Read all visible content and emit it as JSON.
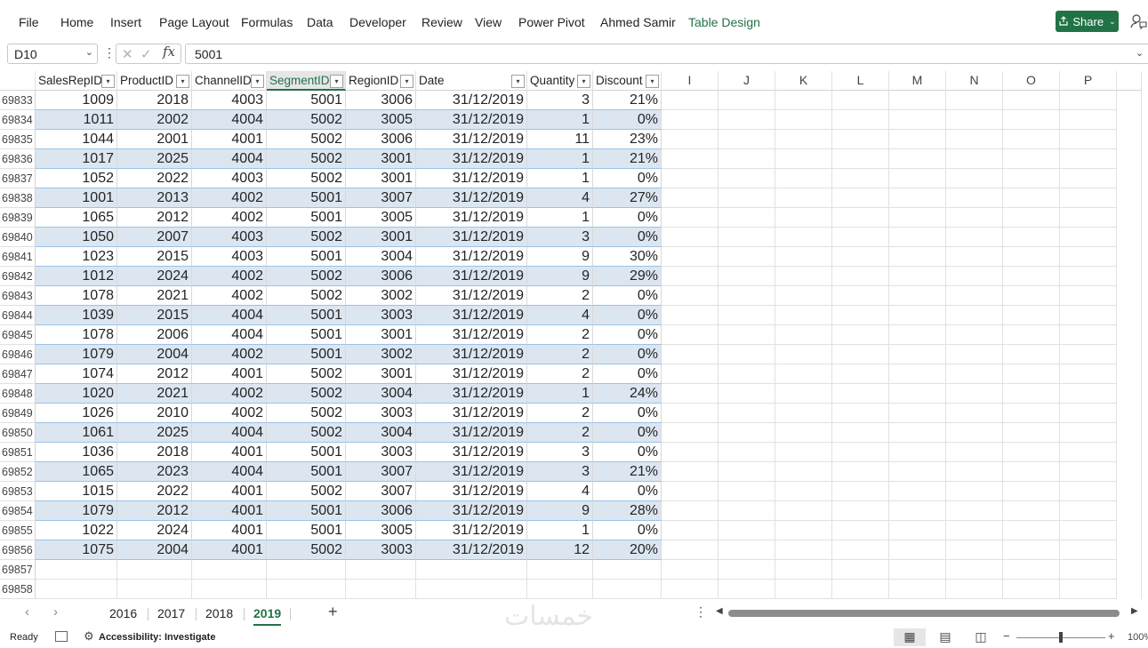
{
  "ribbon": {
    "tabs": [
      "File",
      "Home",
      "Insert",
      "Page Layout",
      "Formulas",
      "Data",
      "Developer",
      "Review",
      "View",
      "Power Pivot",
      "Ahmed Samir",
      "Table Design"
    ],
    "active_tab": "Table Design",
    "share_label": "Share",
    "accent_color": "#217346"
  },
  "formula_bar": {
    "name_box": "D10",
    "fx_label": "fx",
    "formula_value": "5001"
  },
  "grid": {
    "table_headers": [
      "SalesRepID",
      "ProductID",
      "ChannelID",
      "SegmentID",
      "RegionID",
      "Date",
      "Quantity",
      "Discount"
    ],
    "selected_header": "SegmentID",
    "extra_columns": [
      "I",
      "J",
      "K",
      "L",
      "M",
      "N",
      "O",
      "P"
    ],
    "rows": [
      {
        "n": "69833",
        "c": [
          "1009",
          "2018",
          "4003",
          "5001",
          "3006",
          "31/12/2019",
          "3",
          "21%"
        ]
      },
      {
        "n": "69834",
        "c": [
          "1011",
          "2002",
          "4004",
          "5002",
          "3005",
          "31/12/2019",
          "1",
          "0%"
        ]
      },
      {
        "n": "69835",
        "c": [
          "1044",
          "2001",
          "4001",
          "5002",
          "3006",
          "31/12/2019",
          "11",
          "23%"
        ]
      },
      {
        "n": "69836",
        "c": [
          "1017",
          "2025",
          "4004",
          "5002",
          "3001",
          "31/12/2019",
          "1",
          "21%"
        ]
      },
      {
        "n": "69837",
        "c": [
          "1052",
          "2022",
          "4003",
          "5002",
          "3001",
          "31/12/2019",
          "1",
          "0%"
        ]
      },
      {
        "n": "69838",
        "c": [
          "1001",
          "2013",
          "4002",
          "5001",
          "3007",
          "31/12/2019",
          "4",
          "27%"
        ]
      },
      {
        "n": "69839",
        "c": [
          "1065",
          "2012",
          "4002",
          "5001",
          "3005",
          "31/12/2019",
          "1",
          "0%"
        ]
      },
      {
        "n": "69840",
        "c": [
          "1050",
          "2007",
          "4003",
          "5002",
          "3001",
          "31/12/2019",
          "3",
          "0%"
        ]
      },
      {
        "n": "69841",
        "c": [
          "1023",
          "2015",
          "4003",
          "5001",
          "3004",
          "31/12/2019",
          "9",
          "30%"
        ]
      },
      {
        "n": "69842",
        "c": [
          "1012",
          "2024",
          "4002",
          "5002",
          "3006",
          "31/12/2019",
          "9",
          "29%"
        ]
      },
      {
        "n": "69843",
        "c": [
          "1078",
          "2021",
          "4002",
          "5002",
          "3002",
          "31/12/2019",
          "2",
          "0%"
        ]
      },
      {
        "n": "69844",
        "c": [
          "1039",
          "2015",
          "4004",
          "5001",
          "3003",
          "31/12/2019",
          "4",
          "0%"
        ]
      },
      {
        "n": "69845",
        "c": [
          "1078",
          "2006",
          "4004",
          "5001",
          "3001",
          "31/12/2019",
          "2",
          "0%"
        ]
      },
      {
        "n": "69846",
        "c": [
          "1079",
          "2004",
          "4002",
          "5001",
          "3002",
          "31/12/2019",
          "2",
          "0%"
        ]
      },
      {
        "n": "69847",
        "c": [
          "1074",
          "2012",
          "4001",
          "5002",
          "3001",
          "31/12/2019",
          "2",
          "0%"
        ]
      },
      {
        "n": "69848",
        "c": [
          "1020",
          "2021",
          "4002",
          "5002",
          "3004",
          "31/12/2019",
          "1",
          "24%"
        ]
      },
      {
        "n": "69849",
        "c": [
          "1026",
          "2010",
          "4002",
          "5002",
          "3003",
          "31/12/2019",
          "2",
          "0%"
        ]
      },
      {
        "n": "69850",
        "c": [
          "1061",
          "2025",
          "4004",
          "5002",
          "3004",
          "31/12/2019",
          "2",
          "0%"
        ]
      },
      {
        "n": "69851",
        "c": [
          "1036",
          "2018",
          "4001",
          "5001",
          "3003",
          "31/12/2019",
          "3",
          "0%"
        ]
      },
      {
        "n": "69852",
        "c": [
          "1065",
          "2023",
          "4004",
          "5001",
          "3007",
          "31/12/2019",
          "3",
          "21%"
        ]
      },
      {
        "n": "69853",
        "c": [
          "1015",
          "2022",
          "4001",
          "5002",
          "3007",
          "31/12/2019",
          "4",
          "0%"
        ]
      },
      {
        "n": "69854",
        "c": [
          "1079",
          "2012",
          "4001",
          "5001",
          "3006",
          "31/12/2019",
          "9",
          "28%"
        ]
      },
      {
        "n": "69855",
        "c": [
          "1022",
          "2024",
          "4001",
          "5001",
          "3005",
          "31/12/2019",
          "1",
          "0%"
        ]
      },
      {
        "n": "69856",
        "c": [
          "1075",
          "2004",
          "4001",
          "5002",
          "3003",
          "31/12/2019",
          "12",
          "20%"
        ]
      }
    ],
    "empty_rows": [
      "69857",
      "69858"
    ],
    "band_color": "#dce6f1"
  },
  "sheet_tabs": {
    "tabs": [
      "2016",
      "2017",
      "2018",
      "2019"
    ],
    "active": "2019",
    "watermark": "خمسات"
  },
  "status": {
    "ready": "Ready",
    "accessibility": "Accessibility: Investigate",
    "zoom": "100%",
    "zoom_fraction": 1.0
  }
}
